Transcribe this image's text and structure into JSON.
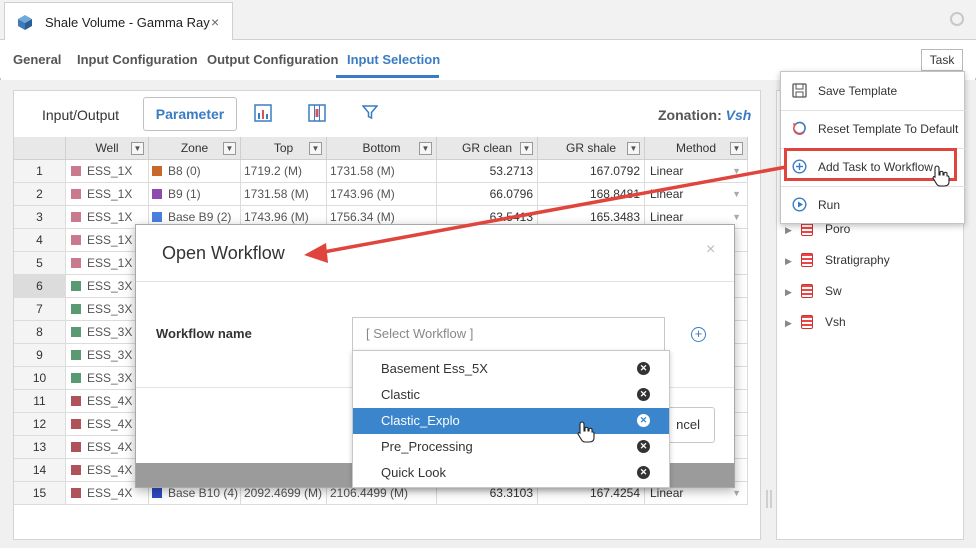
{
  "document_tab": {
    "title": "Shale Volume - Gamma Ray",
    "close": "×"
  },
  "config_tabs": [
    {
      "label": "General"
    },
    {
      "label": "Input Configuration"
    },
    {
      "label": "Output Configuration"
    },
    {
      "label": "Input Selection",
      "active": true
    }
  ],
  "task_button": "Task",
  "toolbar": {
    "input_output": "Input/Output",
    "parameter": "Parameter",
    "zonation_label": "Zonation:",
    "zonation_value": "Vsh"
  },
  "grid": {
    "headers": [
      "Well",
      "Zone",
      "Top",
      "Bottom",
      "GR clean",
      "GR shale",
      "Method"
    ],
    "rows": [
      {
        "n": "1",
        "well": "ESS_1X",
        "wcolor": "#c97a8e",
        "zone": "B8 (0)",
        "zcolor": "#c8682a",
        "top": "1719.2 (M)",
        "bottom": "1731.58 (M)",
        "grc": "53.2713",
        "grs": "167.0792",
        "method": "Linear"
      },
      {
        "n": "2",
        "well": "ESS_1X",
        "wcolor": "#c97a8e",
        "zone": "B9 (1)",
        "zcolor": "#8e4ab0",
        "top": "1731.58 (M)",
        "bottom": "1743.96 (M)",
        "grc": "66.0796",
        "grs": "168.8481",
        "method": "Linear"
      },
      {
        "n": "3",
        "well": "ESS_1X",
        "wcolor": "#c97a8e",
        "zone": "Base B9 (2)",
        "zcolor": "#4a7fe0",
        "top": "1743.96 (M)",
        "bottom": "1756.34 (M)",
        "grc": "63.5413",
        "grs": "165.3483",
        "method": "Linear"
      },
      {
        "n": "4",
        "well": "ESS_1X",
        "wcolor": "#c97a8e",
        "zone": "",
        "zcolor": "",
        "top": "",
        "bottom": "",
        "grc": "",
        "grs": "",
        "method": ""
      },
      {
        "n": "5",
        "well": "ESS_1X",
        "wcolor": "#c97a8e",
        "zone": "",
        "zcolor": "",
        "top": "",
        "bottom": "",
        "grc": "",
        "grs": "",
        "method": ""
      },
      {
        "n": "6",
        "well": "ESS_3X",
        "wcolor": "#5a9a72",
        "zone": "",
        "zcolor": "",
        "top": "",
        "bottom": "",
        "grc": "",
        "grs": "",
        "method": ""
      },
      {
        "n": "7",
        "well": "ESS_3X",
        "wcolor": "#5a9a72",
        "zone": "",
        "zcolor": "",
        "top": "",
        "bottom": "",
        "grc": "",
        "grs": "",
        "method": ""
      },
      {
        "n": "8",
        "well": "ESS_3X",
        "wcolor": "#5a9a72",
        "zone": "",
        "zcolor": "",
        "top": "",
        "bottom": "",
        "grc": "",
        "grs": "",
        "method": ""
      },
      {
        "n": "9",
        "well": "ESS_3X",
        "wcolor": "#5a9a72",
        "zone": "",
        "zcolor": "",
        "top": "",
        "bottom": "",
        "grc": "",
        "grs": "",
        "method": ""
      },
      {
        "n": "10",
        "well": "ESS_3X",
        "wcolor": "#5a9a72",
        "zone": "",
        "zcolor": "",
        "top": "",
        "bottom": "",
        "grc": "",
        "grs": "",
        "method": ""
      },
      {
        "n": "11",
        "well": "ESS_4X",
        "wcolor": "#b0525a",
        "zone": "",
        "zcolor": "",
        "top": "",
        "bottom": "",
        "grc": "",
        "grs": "",
        "method": ""
      },
      {
        "n": "12",
        "well": "ESS_4X",
        "wcolor": "#b0525a",
        "zone": "",
        "zcolor": "",
        "top": "",
        "bottom": "",
        "grc": "",
        "grs": "",
        "method": ""
      },
      {
        "n": "13",
        "well": "ESS_4X",
        "wcolor": "#b0525a",
        "zone": "",
        "zcolor": "",
        "top": "",
        "bottom": "",
        "grc": "",
        "grs": "",
        "method": ""
      },
      {
        "n": "14",
        "well": "ESS_4X",
        "wcolor": "#b0525a",
        "zone": "",
        "zcolor": "",
        "top": "",
        "bottom": "",
        "grc": "",
        "grs": "",
        "method": ""
      },
      {
        "n": "15",
        "well": "ESS_4X",
        "wcolor": "#b0525a",
        "zone": "Base B10 (4)",
        "zcolor": "#2e4bc2",
        "top": "2092.4699 (M)",
        "bottom": "2106.4499 (M)",
        "grc": "63.3103",
        "grs": "167.4254",
        "method": "Linear"
      }
    ]
  },
  "tree": [
    {
      "label": "Poro"
    },
    {
      "label": "Stratigraphy"
    },
    {
      "label": "Sw"
    },
    {
      "label": "Vsh"
    }
  ],
  "task_menu": [
    {
      "label": "Save Template",
      "icon": "save-icon"
    },
    {
      "label": "Reset Template To Default",
      "icon": "reset-icon"
    },
    {
      "label": "Add Task to Workflow",
      "icon": "add-circle-icon"
    },
    {
      "label": "Run",
      "icon": "play-icon"
    }
  ],
  "modal": {
    "title": "Open Workflow",
    "close": "×",
    "field_label": "Workflow name",
    "placeholder": "[ Select Workflow ]",
    "cancel": "ncel",
    "options": [
      {
        "label": "Basement Ess_5X"
      },
      {
        "label": "Clastic"
      },
      {
        "label": "Clastic_Explo",
        "active": true
      },
      {
        "label": "Pre_Processing"
      },
      {
        "label": "Quick Look"
      }
    ]
  },
  "colors": {
    "accent": "#3a7cc4",
    "highlight": "#e0453d",
    "dropdown_active": "#3a85cc"
  }
}
